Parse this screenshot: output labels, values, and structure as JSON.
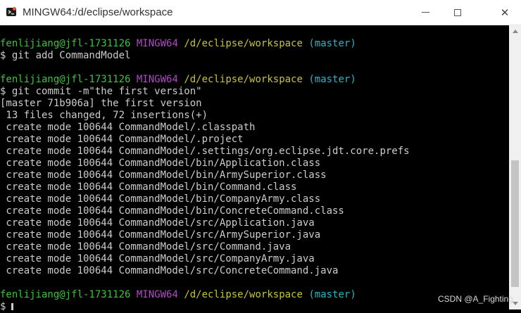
{
  "window": {
    "title": "MINGW64:/d/eclipse/workspace",
    "icon": "git-bash-icon"
  },
  "controls": {
    "minimize": "minimize-icon",
    "maximize": "maximize-icon",
    "close": "close-icon",
    "close_glyph": "✕"
  },
  "prompt": {
    "user": "fenlijiang@jfl-1731126",
    "host": "MINGW64",
    "path": "/d/eclipse/workspace",
    "branch": "(master)"
  },
  "commands": {
    "add": "$ git add CommandModel",
    "commit": "$ git commit -m\"the first version\""
  },
  "output": {
    "commit_header": "[master 71b906a] the first version",
    "summary": " 13 files changed, 72 insertions(+)",
    "created": [
      " create mode 100644 CommandModel/.classpath",
      " create mode 100644 CommandModel/.project",
      " create mode 100644 CommandModel/.settings/org.eclipse.jdt.core.prefs",
      " create mode 100644 CommandModel/bin/Application.class",
      " create mode 100644 CommandModel/bin/ArmySuperior.class",
      " create mode 100644 CommandModel/bin/Command.class",
      " create mode 100644 CommandModel/bin/CompanyArmy.class",
      " create mode 100644 CommandModel/bin/ConcreteCommand.class",
      " create mode 100644 CommandModel/src/Application.java",
      " create mode 100644 CommandModel/src/ArmySuperior.java",
      " create mode 100644 CommandModel/src/Command.java",
      " create mode 100644 CommandModel/src/CompanyArmy.java",
      " create mode 100644 CommandModel/src/ConcreteCommand.java"
    ]
  },
  "final_prompt_symbol": "$",
  "watermark": "CSDN @A_Fighting",
  "colors": {
    "user": "#39c43a",
    "host": "#b148c6",
    "path": "#c7c430",
    "branch": "#21b7c9",
    "text": "#cccccc",
    "background": "#000000"
  }
}
